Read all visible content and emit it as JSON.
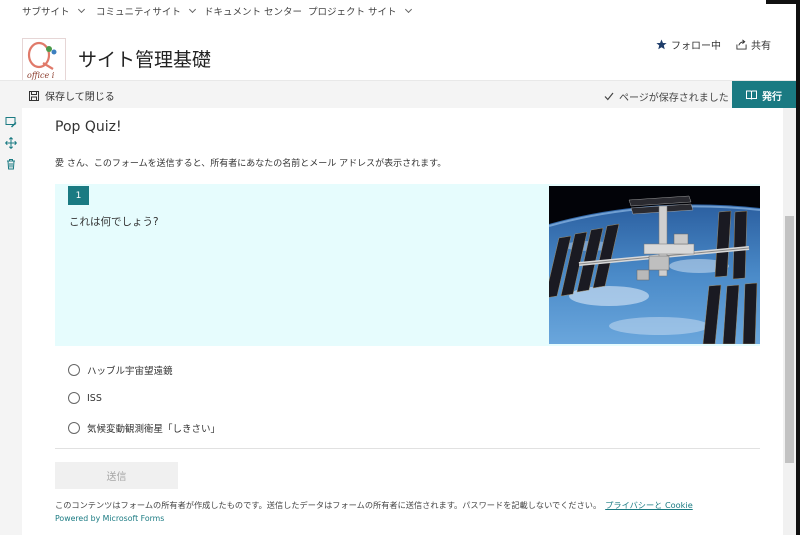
{
  "topnav": {
    "items": [
      {
        "label": "サブサイト"
      },
      {
        "label": "コミュニティサイト"
      },
      {
        "label": "ドキュメント センター"
      },
      {
        "label": "プロジェクト サイト"
      }
    ]
  },
  "header": {
    "logo_text": "office i",
    "site_title": "サイト管理基礎",
    "follow_label": "フォロー中",
    "share_label": "共有"
  },
  "cmdbar": {
    "save_close_label": "保存して閉じる",
    "saved_status": "ページが保存されました",
    "publish_label": "発行"
  },
  "quiz": {
    "title": "Pop Quiz!",
    "description": "愛 さん、このフォームを送信すると、所有者にあなたの名前とメール アドレスが表示されます。",
    "question_number": "1",
    "question_text": "これは何でしょう?",
    "options": [
      {
        "label": "ハッブル宇宙望遠鏡"
      },
      {
        "label": "ISS"
      },
      {
        "label": "気候変動観測衛星「しきさい」"
      }
    ],
    "submit_label": "送信",
    "footer_note": "このコンテンツはフォームの所有者が作成したものです。送信したデータはフォームの所有者に送信されます。パスワードを記載しないでください。",
    "privacy_link": "プライバシーと Cookie",
    "powered_by": "Powered by Microsoft Forms"
  },
  "colors": {
    "accent": "#1a7a82",
    "question_bg": "#e6fcfd"
  }
}
